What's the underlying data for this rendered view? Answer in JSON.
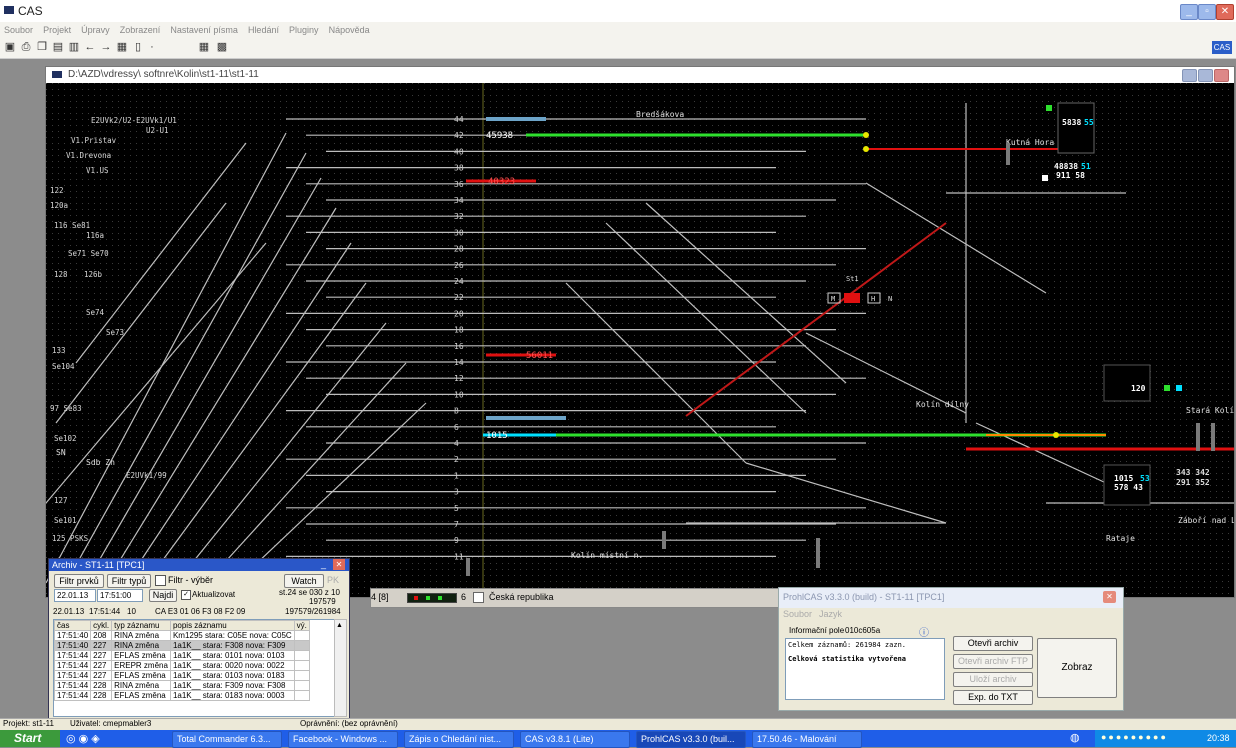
{
  "app": {
    "title": "CAS",
    "menu": [
      "Soubor",
      "Projekt",
      "Úpravy",
      "Zobrazení",
      "Nastavení písma",
      "Hledání",
      "Pluginy",
      "Nápověda"
    ],
    "toolbar_icons": [
      "open-icon",
      "print-icon",
      "copy-icon",
      "paste-icon",
      "cut-icon",
      "back-icon",
      "forward-icon",
      "grid-icon",
      "page-icon",
      "dropdown-icon",
      "table-icon",
      "layout-icon"
    ],
    "corner_badge": "CAS"
  },
  "child": {
    "title": "D:\\AZD\\vdressy\\ softnre\\Kolin\\st1-11\\st1-11"
  },
  "track": {
    "labels_top_left": [
      "E2UVk2/U2-E2UVk1/U1",
      "U2-U1",
      "V1.Pristav",
      "V1.Drevona",
      "V1.US",
      "122",
      "120a",
      "116 Se81",
      "116a",
      "Se71 Se70",
      "128",
      "126b",
      "Se74",
      "Se73",
      "133",
      "Se104",
      "97 Se83",
      "Se102",
      "E2UVk1/99",
      "127",
      "125 PSKS",
      "Se101"
    ],
    "labels_center": [
      "44",
      "42",
      "40",
      "38",
      "36",
      "34",
      "32",
      "30",
      "28",
      "26",
      "24",
      "22",
      "20",
      "18",
      "16",
      "14",
      "12",
      "10",
      "8",
      "6",
      "4",
      "2",
      "1",
      "3",
      "5",
      "7",
      "9",
      "11"
    ],
    "train_numbers": [
      "45938",
      "40323",
      "56011",
      "1015"
    ],
    "station_names": [
      "Bredšákova",
      "Kutná Hora",
      "Kolín dílny",
      "Kolín místní n.",
      "Záboří nad Labem",
      "Rataje",
      "Stará Kolín",
      "Sdb Zn",
      "SN"
    ],
    "right_boxes": [
      {
        "top": "5838",
        "bottom": "55"
      },
      {
        "top": "48838",
        "middle": "51",
        "bottom": "911 58"
      },
      {
        "top": "120"
      },
      {
        "top": "1015",
        "middle": "53",
        "bottom": "578 43"
      },
      {
        "top": "343 342",
        "bottom": "291 352"
      }
    ],
    "mini_signal_labels": [
      "St1",
      "M",
      "H",
      "N"
    ]
  },
  "lower_strip": {
    "field1": "4 [8]",
    "field2": "Česká republika",
    "value": "6"
  },
  "archive": {
    "title": "Archiv - ST1-11 [TPC1]",
    "btn_filter_station": "Filtr prvků",
    "btn_filter_type": "Filtr typů",
    "chk_filter_select": "Filtr - výběr",
    "btn_watch": "Watch",
    "btn_pk": "PK",
    "date_from": "22.01.13",
    "time_from": "17:51:00",
    "btn_find": "Najdi",
    "chk_actual": "Aktualizovat",
    "info_line1": "st.24 se 030 z 10",
    "info_line2": "197579",
    "row_summary": [
      "22.01.13",
      "17:51:44",
      "10",
      "CA E3 01 06 F3 08 F2 09",
      "197579/261984"
    ],
    "columns": [
      "čas",
      "cykl.",
      "typ záznamu",
      "popis záznamu",
      "vý."
    ],
    "rows": [
      [
        "17:51:40",
        "208",
        "RINA změna",
        "Km1295 stara: C05E nova: C05C",
        ""
      ],
      [
        "17:51:40",
        "227",
        "RINA změna",
        "1a1K__ stara: F308 nova: F309",
        ""
      ],
      [
        "17:51:44",
        "227",
        "EFLAS změna",
        "1a1K__ stara: 0101 nova: 0103",
        ""
      ],
      [
        "17:51:44",
        "227",
        "EREPR změna",
        "1a1K__ stara: 0020 nova: 0022",
        ""
      ],
      [
        "17:51:44",
        "227",
        "EFLAS změna",
        "1a1K__ stara: 0103 nova: 0183",
        ""
      ],
      [
        "17:51:44",
        "228",
        "RINA změna",
        "1a1K__ stara: F309 nova: F308",
        ""
      ],
      [
        "17:51:44",
        "228",
        "EFLAS změna",
        "1a1K__ stara: 0183 nova: 0003",
        ""
      ]
    ]
  },
  "proh": {
    "title": "ProhlCAS v3.3.0 (build) - ST1-11 [TPC1]",
    "menu": [
      "Soubor",
      "Jazyk"
    ],
    "info_label": "Informační pole",
    "info_value": "010c605a",
    "text_line1": "Celkem záznamů: 261984 zazn.",
    "text_line2": "Celková statistika vytvořena",
    "btn_open_archive": "Otevři archiv",
    "btn_open_ftp": "Otevři archiv FTP",
    "btn_delete": "Uloží archiv",
    "btn_export": "Exp. do TXT",
    "btn_show": "Zobraz"
  },
  "status": {
    "project": "Projekt: st1-11",
    "user": "Uživatel: cmepmabler3",
    "rights": "Oprávnění: (bez oprávnění)"
  },
  "taskbar": {
    "start": "Start",
    "tasks": [
      "Total Commander 6.3...",
      "Facebook - Windows ...",
      "Zápis o Chledání nist...",
      "CAS v3.8.1 (Lite)",
      "ProhlCAS v3.3.0 (buil...",
      "17.50.46 - Malování"
    ],
    "clock": "20:38"
  },
  "colors": {
    "green": "#2ee02e",
    "red": "#e01010",
    "cyan": "#00e0ff",
    "yellow": "#e8e800",
    "track_white": "#c8c8c8"
  }
}
